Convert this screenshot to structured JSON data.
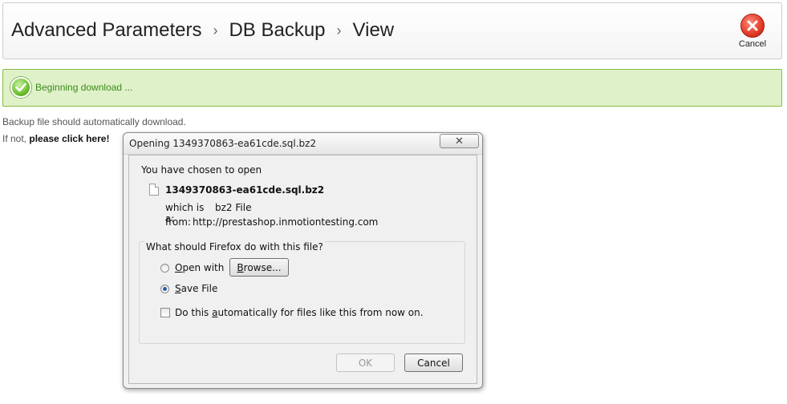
{
  "header": {
    "breadcrumb": [
      "Advanced Parameters",
      "DB Backup",
      "View"
    ],
    "cancel_label": "Cancel"
  },
  "success": {
    "message": "Beginning download ..."
  },
  "body": {
    "line1": "Backup file should automatically download.",
    "line2_prefix": "If not,",
    "line2_link": "please click here!"
  },
  "dialog": {
    "title": "Opening 1349370863-ea61cde.sql.bz2",
    "heading": "You have chosen to open",
    "file_name": "1349370863-ea61cde.sql.bz2",
    "which_is_label": "which is a:",
    "which_is_value": "bz2 File",
    "from_label": "from:",
    "from_value": "http://prestashop.inmotiontesting.com",
    "group_label": "What should Firefox do with this file?",
    "open_with": {
      "pre": "",
      "acc": "O",
      "post": "pen with"
    },
    "browse": {
      "pre": "",
      "acc": "B",
      "post": "rowse..."
    },
    "save_file": {
      "pre": "",
      "acc": "S",
      "post": "ave File"
    },
    "auto": {
      "pre": "Do this ",
      "acc": "a",
      "post": "utomatically for files like this from now on."
    },
    "selected_option": "save_file",
    "auto_checked": false,
    "ok_label": "OK",
    "cancel_label": "Cancel"
  },
  "colors": {
    "success_bg": "#dff1c8",
    "success_border": "#86bd45",
    "success_text": "#3c8a1b",
    "cancel_red": "#e23a25"
  },
  "icons": {
    "cancel": "close-circle-icon",
    "success": "checkmark-circle-icon",
    "file": "file-icon",
    "close": "close-icon"
  }
}
